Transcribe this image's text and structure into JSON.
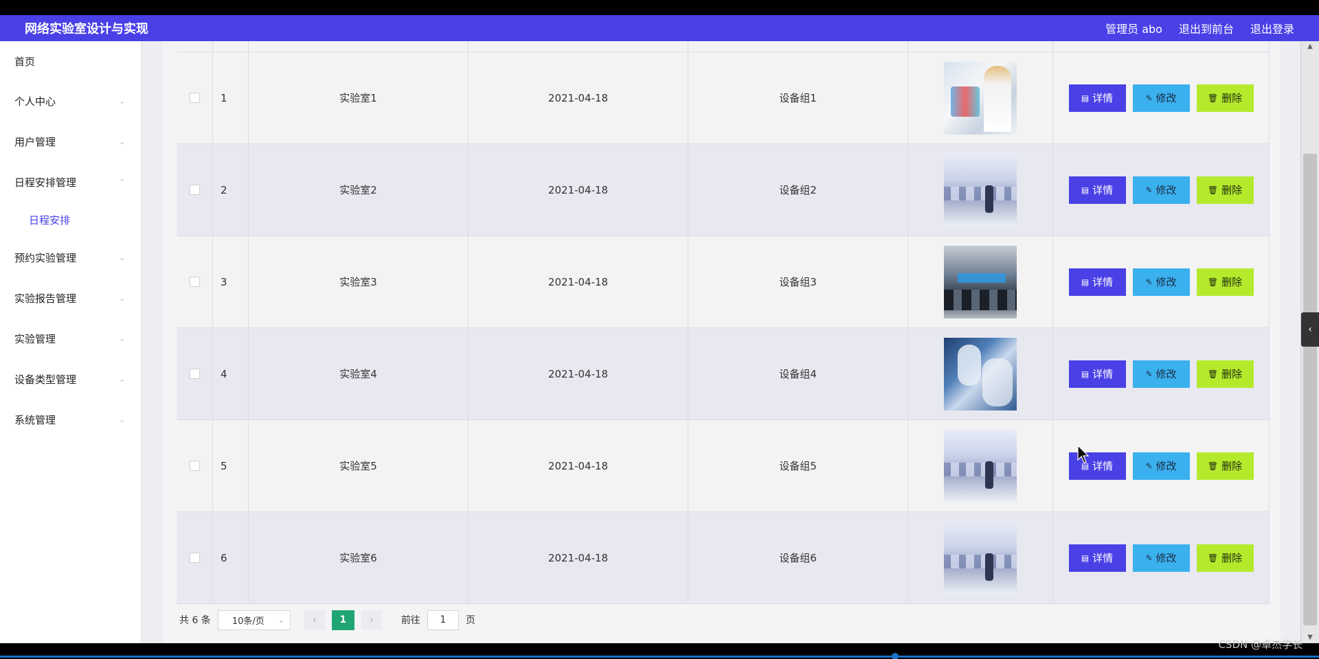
{
  "header": {
    "title": "网络实验室设计与实现",
    "nav": [
      "管理员 abo",
      "退出到前台",
      "退出登录"
    ]
  },
  "sidebar": {
    "items": [
      {
        "label": "首页",
        "expandable": false
      },
      {
        "label": "个人中心",
        "expandable": true
      },
      {
        "label": "用户管理",
        "expandable": true
      },
      {
        "label": "日程安排管理",
        "expandable": true,
        "expanded": true,
        "children": [
          "日程安排"
        ]
      },
      {
        "label": "预约实验管理",
        "expandable": true
      },
      {
        "label": "实验报告管理",
        "expandable": true
      },
      {
        "label": "实验管理",
        "expandable": true
      },
      {
        "label": "设备类型管理",
        "expandable": true
      },
      {
        "label": "系统管理",
        "expandable": true
      }
    ]
  },
  "table": {
    "rows": [
      {
        "index": "1",
        "name": "实验室1",
        "date": "2021-04-18",
        "group": "设备组1",
        "image": "lab-a"
      },
      {
        "index": "2",
        "name": "实验室2",
        "date": "2021-04-18",
        "group": "设备组2",
        "image": "lab-b"
      },
      {
        "index": "3",
        "name": "实验室3",
        "date": "2021-04-18",
        "group": "设备组3",
        "image": "lab-c"
      },
      {
        "index": "4",
        "name": "实验室4",
        "date": "2021-04-18",
        "group": "设备组4",
        "image": "lab-d"
      },
      {
        "index": "5",
        "name": "实验室5",
        "date": "2021-04-18",
        "group": "设备组5",
        "image": "lab-b"
      },
      {
        "index": "6",
        "name": "实验室6",
        "date": "2021-04-18",
        "group": "设备组6",
        "image": "lab-b"
      }
    ],
    "actions": {
      "detail": "详情",
      "edit": "修改",
      "delete": "删除"
    }
  },
  "pagination": {
    "total": "共 6 条",
    "page_size": "10条/页",
    "current_page": "1",
    "goto_prefix": "前往",
    "goto_value": "1",
    "goto_suffix": "页"
  },
  "watermark": "CSDN @卓杰学长",
  "colors": {
    "primary": "#4940e6",
    "edit": "#3ab0ee",
    "delete": "#b5ea2c",
    "page_active": "#1fa574"
  }
}
